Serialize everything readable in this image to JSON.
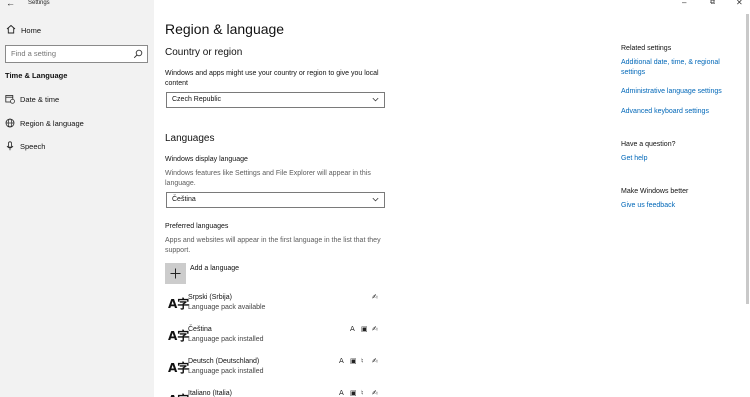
{
  "window": {
    "app_title": "Settings"
  },
  "sidebar": {
    "home_label": "Home",
    "search_placeholder": "Find a setting",
    "section_title": "Time & Language",
    "items": [
      {
        "label": "Date & time",
        "icon": "calendar-clock-icon"
      },
      {
        "label": "Region & language",
        "icon": "globe-icon"
      },
      {
        "label": "Speech",
        "icon": "microphone-icon"
      }
    ]
  },
  "main": {
    "page_title": "Region & language",
    "country": {
      "heading": "Country or region",
      "description": "Windows and apps might use your country or region to give you local content",
      "selected": "Czech Republic"
    },
    "languages": {
      "heading": "Languages",
      "display_label": "Windows display language",
      "display_description": "Windows features like Settings and File Explorer will appear in this language.",
      "display_selected": "Čeština",
      "preferred_label": "Preferred languages",
      "preferred_description": "Apps and websites will appear in the first language in the list that they support.",
      "add_label": "Add a language",
      "list": [
        {
          "name": "Srpski (Srbija)",
          "status": "Language pack available"
        },
        {
          "name": "Čeština",
          "status": "Language pack installed"
        },
        {
          "name": "Deutsch (Deutschland)",
          "status": "Language pack installed"
        },
        {
          "name": "Italiano (Italia)",
          "status": ""
        }
      ]
    }
  },
  "right": {
    "related_heading": "Related settings",
    "links": [
      "Additional date, time, & regional settings",
      "Administrative language settings",
      "Advanced keyboard settings"
    ],
    "question_heading": "Have a question?",
    "help_link": "Get help",
    "better_heading": "Make Windows better",
    "feedback_link": "Give us feedback"
  },
  "colors": {
    "accent": "#0067b8",
    "sidebar_bg": "#f2f2f2",
    "add_button_bg": "#cccccc"
  }
}
